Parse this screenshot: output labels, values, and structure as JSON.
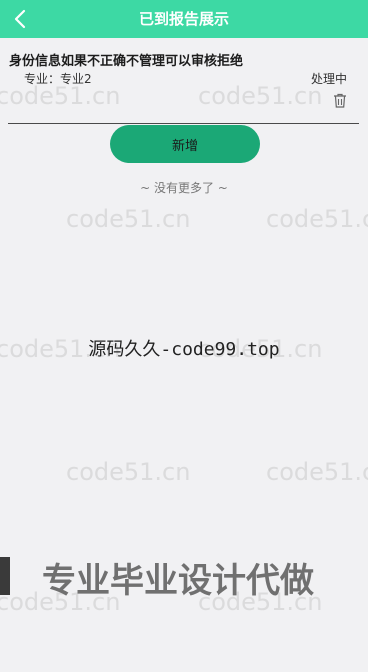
{
  "header": {
    "title": "已到报告展示",
    "back_icon": "chevron-left-icon"
  },
  "record": {
    "title": "身份信息如果不正确不管理可以审核拒绝",
    "major": "专业：专业2",
    "status": "处理中",
    "delete_icon": "trash-icon"
  },
  "actions": {
    "add_label": "新增"
  },
  "list": {
    "no_more_text": "~ 没有更多了 ~"
  },
  "watermarks": {
    "repeat_text": "code51.cn",
    "center_text": "源码久久-code99.top",
    "banner_text": "专业毕业设计代做"
  },
  "colors": {
    "header": "#3dd9a4",
    "add_button": "#1ba876",
    "background": "#f1f1f3"
  }
}
